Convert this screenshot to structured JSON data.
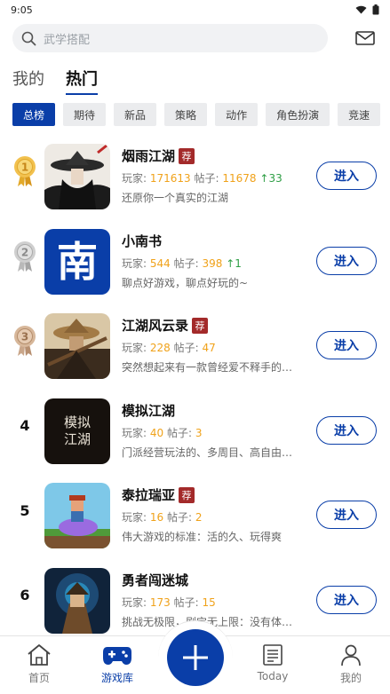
{
  "status": {
    "time": "9:05"
  },
  "search": {
    "placeholder": "武学搭配"
  },
  "tabs": [
    {
      "label": "我的"
    },
    {
      "label": "热门"
    }
  ],
  "categories": [
    {
      "label": "总榜"
    },
    {
      "label": "期待"
    },
    {
      "label": "新品"
    },
    {
      "label": "策略"
    },
    {
      "label": "动作"
    },
    {
      "label": "角色扮演"
    },
    {
      "label": "竞速"
    }
  ],
  "games": [
    {
      "rank": "1",
      "name": "烟雨江湖",
      "badge": "荐",
      "players_label": "玩家:",
      "players": "171613",
      "posts_label": "帖子:",
      "posts": "11678",
      "up": "↑33",
      "desc": "还原你一个真实的江湖",
      "button": "进入"
    },
    {
      "rank": "2",
      "name": "小南书",
      "badge": "",
      "players_label": "玩家:",
      "players": "544",
      "posts_label": "帖子:",
      "posts": "398",
      "up": "↑1",
      "desc": "聊点好游戏，聊点好玩的~",
      "button": "进入",
      "icon_text": "南"
    },
    {
      "rank": "3",
      "name": "江湖风云录",
      "badge": "荐",
      "players_label": "玩家:",
      "players": "228",
      "posts_label": "帖子:",
      "posts": "47",
      "up": "",
      "desc": "突然想起来有一款曾经爱不释手的…",
      "button": "进入"
    },
    {
      "rank": "4",
      "name": "模拟江湖",
      "badge": "",
      "players_label": "玩家:",
      "players": "40",
      "posts_label": "帖子:",
      "posts": "3",
      "up": "",
      "desc": "门派经营玩法的、多周目、高自由…",
      "button": "进入",
      "icon_text": "模拟江湖"
    },
    {
      "rank": "5",
      "name": "泰拉瑞亚",
      "badge": "荐",
      "players_label": "玩家:",
      "players": "16",
      "posts_label": "帖子:",
      "posts": "2",
      "up": "",
      "desc": "伟大游戏的标准：活的久、玩得爽",
      "button": "进入"
    },
    {
      "rank": "6",
      "name": "勇者闯迷城",
      "badge": "",
      "players_label": "玩家:",
      "players": "173",
      "posts_label": "帖子:",
      "posts": "15",
      "up": "",
      "desc": "挑战无极限，剧宝无上限：没有体…",
      "button": "进入"
    }
  ],
  "nav": {
    "home": "首页",
    "library": "游戏库",
    "today": "Today",
    "mine": "我的"
  },
  "colors": {
    "accent": "#0a3ea8",
    "number": "#f0a21a",
    "up": "#2e9e45",
    "badge": "#a32a2a"
  }
}
